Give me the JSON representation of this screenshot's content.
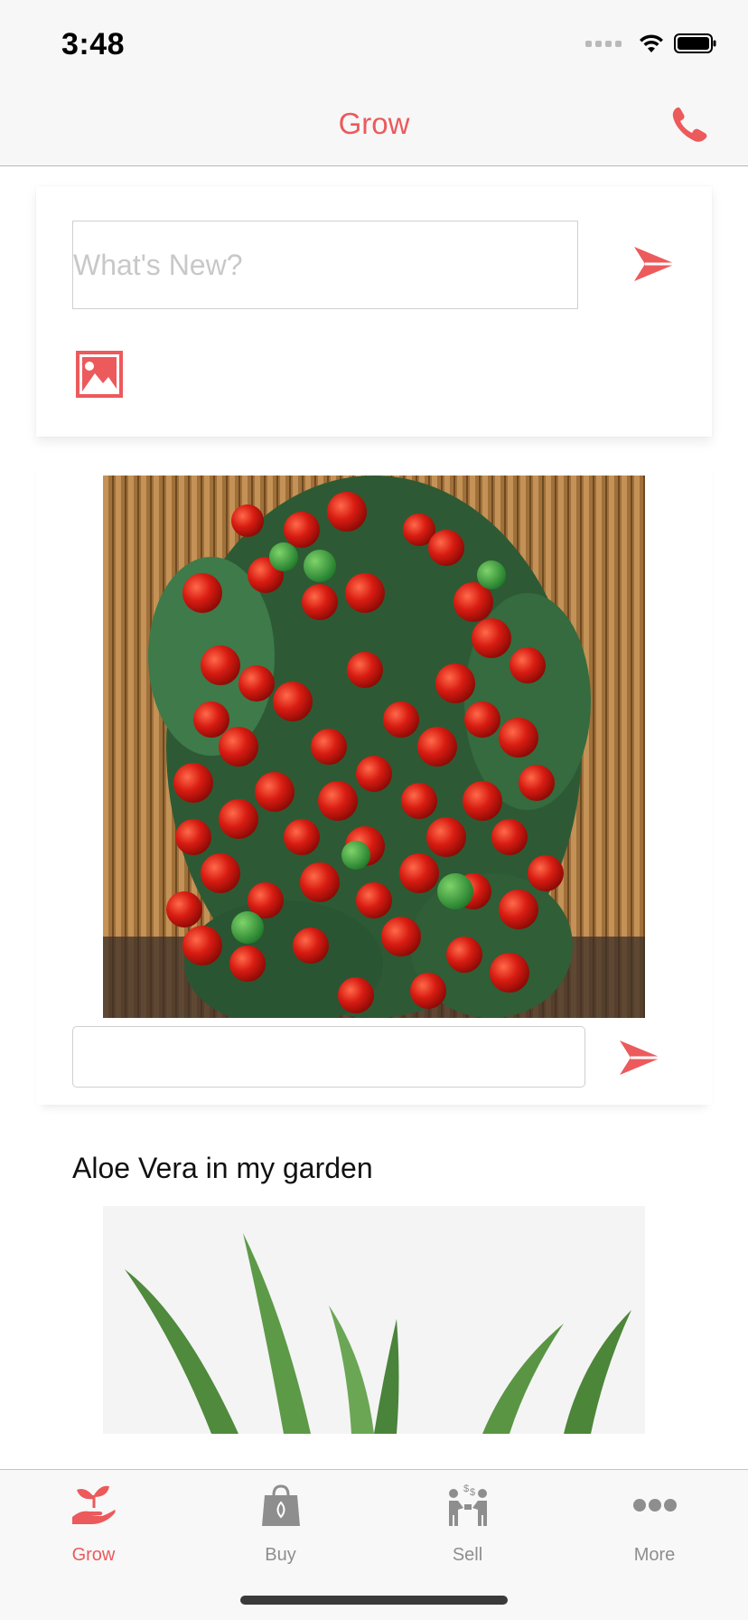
{
  "status_bar": {
    "time": "3:48",
    "icons": [
      "signal-icon",
      "wifi-icon",
      "battery-icon"
    ]
  },
  "nav": {
    "title": "Grow",
    "right_icon": "phone-icon"
  },
  "composer": {
    "placeholder": "What's New?",
    "send_icon": "send-icon",
    "image_icon": "image-icon"
  },
  "posts": [
    {
      "title": "",
      "image": "cherry-tomato-plant-photo",
      "comment_value": "",
      "send_icon": "send-icon"
    },
    {
      "title": "Aloe Vera in my garden",
      "image": "aloe-vera-photo"
    }
  ],
  "tab_bar": {
    "items": [
      {
        "label": "Grow",
        "icon": "grow-hand-plant-icon",
        "active": true
      },
      {
        "label": "Buy",
        "icon": "shopping-bag-icon",
        "active": false
      },
      {
        "label": "Sell",
        "icon": "sell-people-icon",
        "active": false
      },
      {
        "label": "More",
        "icon": "more-dots-icon",
        "active": false
      }
    ]
  },
  "colors": {
    "accent": "#ec5a5c",
    "inactive": "#8e8e8e",
    "bar_background": "#f7f7f7"
  }
}
